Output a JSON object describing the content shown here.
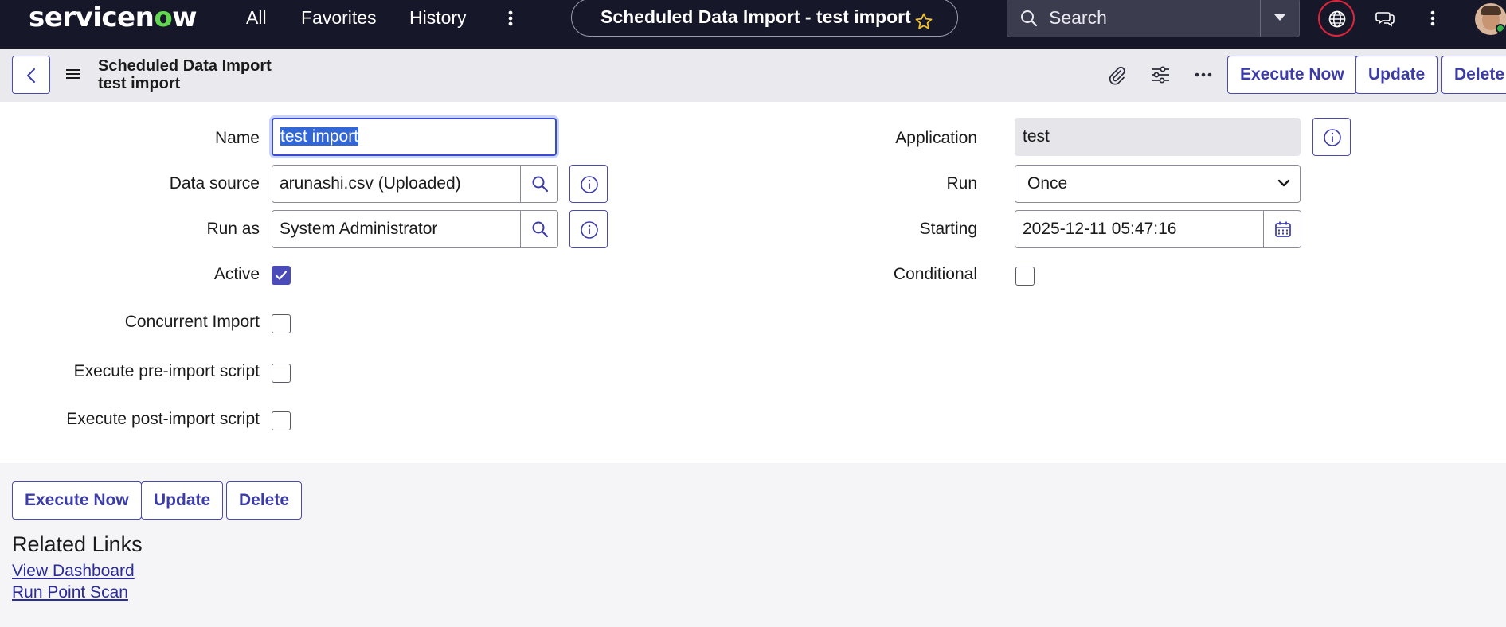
{
  "topbar": {
    "logo": {
      "text_a": "servicen",
      "text_o": "o",
      "text_b": "w"
    },
    "nav": [
      "All",
      "Favorites",
      "History"
    ],
    "title": "Scheduled Data Import - test import",
    "search_placeholder": "Search",
    "icons": [
      "more-vertical-icon",
      "star-icon",
      "search-icon",
      "chevron-down-icon",
      "globe-icon",
      "chat-icon",
      "more-vertical-icon",
      "avatar"
    ]
  },
  "header": {
    "title_line1": "Scheduled Data Import",
    "title_line2": "test import",
    "buttons": [
      "Execute Now",
      "Update",
      "Delete"
    ],
    "icons": [
      "back-arrow-icon",
      "hamburger-icon",
      "paperclip-icon",
      "sliders-icon",
      "more-horizontal-icon"
    ]
  },
  "form": {
    "name": {
      "label": "Name",
      "value": "test import"
    },
    "data_source": {
      "label": "Data source",
      "value": "arunashi.csv (Uploaded)"
    },
    "run_as": {
      "label": "Run as",
      "value": "System Administrator"
    },
    "active": {
      "label": "Active",
      "checked": true
    },
    "concurrent_import": {
      "label": "Concurrent Import",
      "checked": false
    },
    "pre_import": {
      "label": "Execute pre-import script",
      "checked": false
    },
    "post_import": {
      "label": "Execute post-import script",
      "checked": false
    },
    "application": {
      "label": "Application",
      "value": "test"
    },
    "run": {
      "label": "Run",
      "value": "Once"
    },
    "starting": {
      "label": "Starting",
      "value": "2025-12-11 05:47:16"
    },
    "conditional": {
      "label": "Conditional",
      "checked": false
    }
  },
  "footer": {
    "buttons": [
      "Execute Now",
      "Update",
      "Delete"
    ],
    "related_title": "Related Links",
    "links": [
      "View Dashboard",
      "Run Point Scan"
    ]
  },
  "colors": {
    "nav_bg": "#17172a",
    "accent": "#3c3ca8",
    "logo_green": "#62d84e",
    "focus": "#3a4bd0",
    "alert_ring": "#e0253a"
  }
}
